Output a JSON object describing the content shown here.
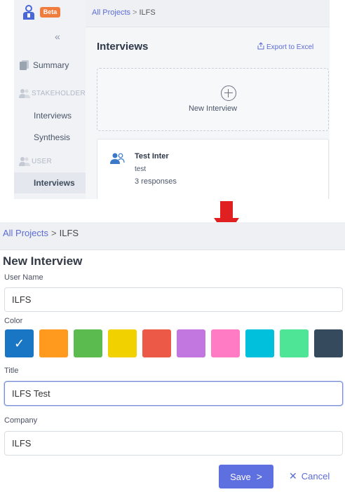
{
  "top": {
    "beta_label": "Beta",
    "collapse_icon": "«",
    "sidebar": {
      "summary": "Summary",
      "stakeholder": "STAKEHOLDER",
      "stakeholder_interviews": "Interviews",
      "synthesis": "Synthesis",
      "user": "USER",
      "user_interviews": "Interviews"
    },
    "breadcrumb": {
      "link": "All Projects",
      "current": "ILFS"
    },
    "title": "Interviews",
    "export_label": "Export to Excel",
    "new_interview_label": "New Interview",
    "card": {
      "title": "Test Inter",
      "subtitle": "test",
      "responses": "3 responses"
    }
  },
  "form": {
    "breadcrumb": {
      "link": "All Projects",
      "current": "ILFS"
    },
    "title": "New Interview",
    "user_name_label": "User Name",
    "user_name_value": "ILFS",
    "color_label": "Color",
    "colors": [
      "#1976c4",
      "#ff9a1f",
      "#5cbb4e",
      "#f1d200",
      "#ec5a47",
      "#c276e0",
      "#ff7cc5",
      "#00c0dc",
      "#4ee596",
      "#354b5d"
    ],
    "selected_color_index": 0,
    "title_label": "Title",
    "title_value": "ILFS Test",
    "company_label": "Company",
    "company_value": "ILFS",
    "save_label": "Save",
    "cancel_label": "Cancel"
  },
  "accent": "#5e6fe0",
  "arrow_color": "#e02020"
}
